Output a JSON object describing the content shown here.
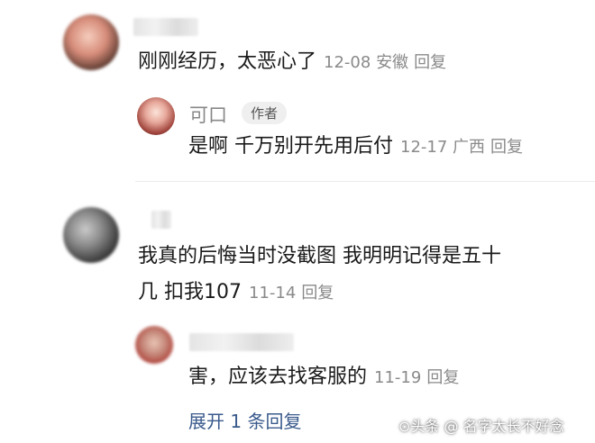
{
  "comments": [
    {
      "text": "刚刚经历，太恶心了",
      "date": "12-08",
      "location": "安徽",
      "reply_label": "回复",
      "replies": [
        {
          "name": "可口",
          "badge": "作者",
          "text": "是啊 千万别开先用后付",
          "date": "12-17",
          "location": "广西",
          "reply_label": "回复"
        }
      ]
    },
    {
      "text_line1": "我真的后悔当时没截图 我明明记得是五十",
      "text_line2": "几 扣我107",
      "date": "11-14",
      "reply_label": "回复",
      "replies": [
        {
          "text": "害，应该去找客服的",
          "date": "11-19",
          "reply_label": "回复"
        }
      ],
      "expand_label": "展开 1 条回复"
    }
  ],
  "watermark": "⊙头条 @ 名字太长不好念"
}
